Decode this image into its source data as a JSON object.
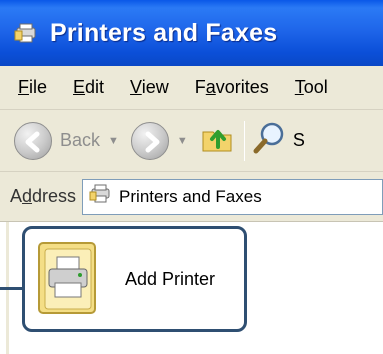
{
  "window": {
    "title": "Printers and Faxes",
    "title_icon": "printers-folder-icon"
  },
  "menubar": {
    "items": [
      {
        "label_ul": "F",
        "label_rest": "ile"
      },
      {
        "label_ul": "E",
        "label_rest": "dit"
      },
      {
        "label_ul": "V",
        "label_rest": "iew"
      },
      {
        "label_pre": "F",
        "label_ul": "a",
        "label_rest": "vorites"
      },
      {
        "label_ul": "T",
        "label_rest": "ool"
      }
    ]
  },
  "toolbar": {
    "back_label": "Back",
    "search_label": "S",
    "icons": [
      "back-arrow-icon",
      "forward-arrow-icon",
      "up-folder-icon",
      "search-magnifier-icon"
    ]
  },
  "address": {
    "label_pre": "A",
    "label_ul": "d",
    "label_rest": "dress",
    "value": "Printers and Faxes"
  },
  "content": {
    "items": [
      {
        "label": "Add Printer",
        "icon": "add-printer-icon"
      }
    ]
  },
  "colors": {
    "titlebar": "#0b4fd8",
    "chrome": "#ece9d8",
    "callout": "#2f4f72"
  }
}
